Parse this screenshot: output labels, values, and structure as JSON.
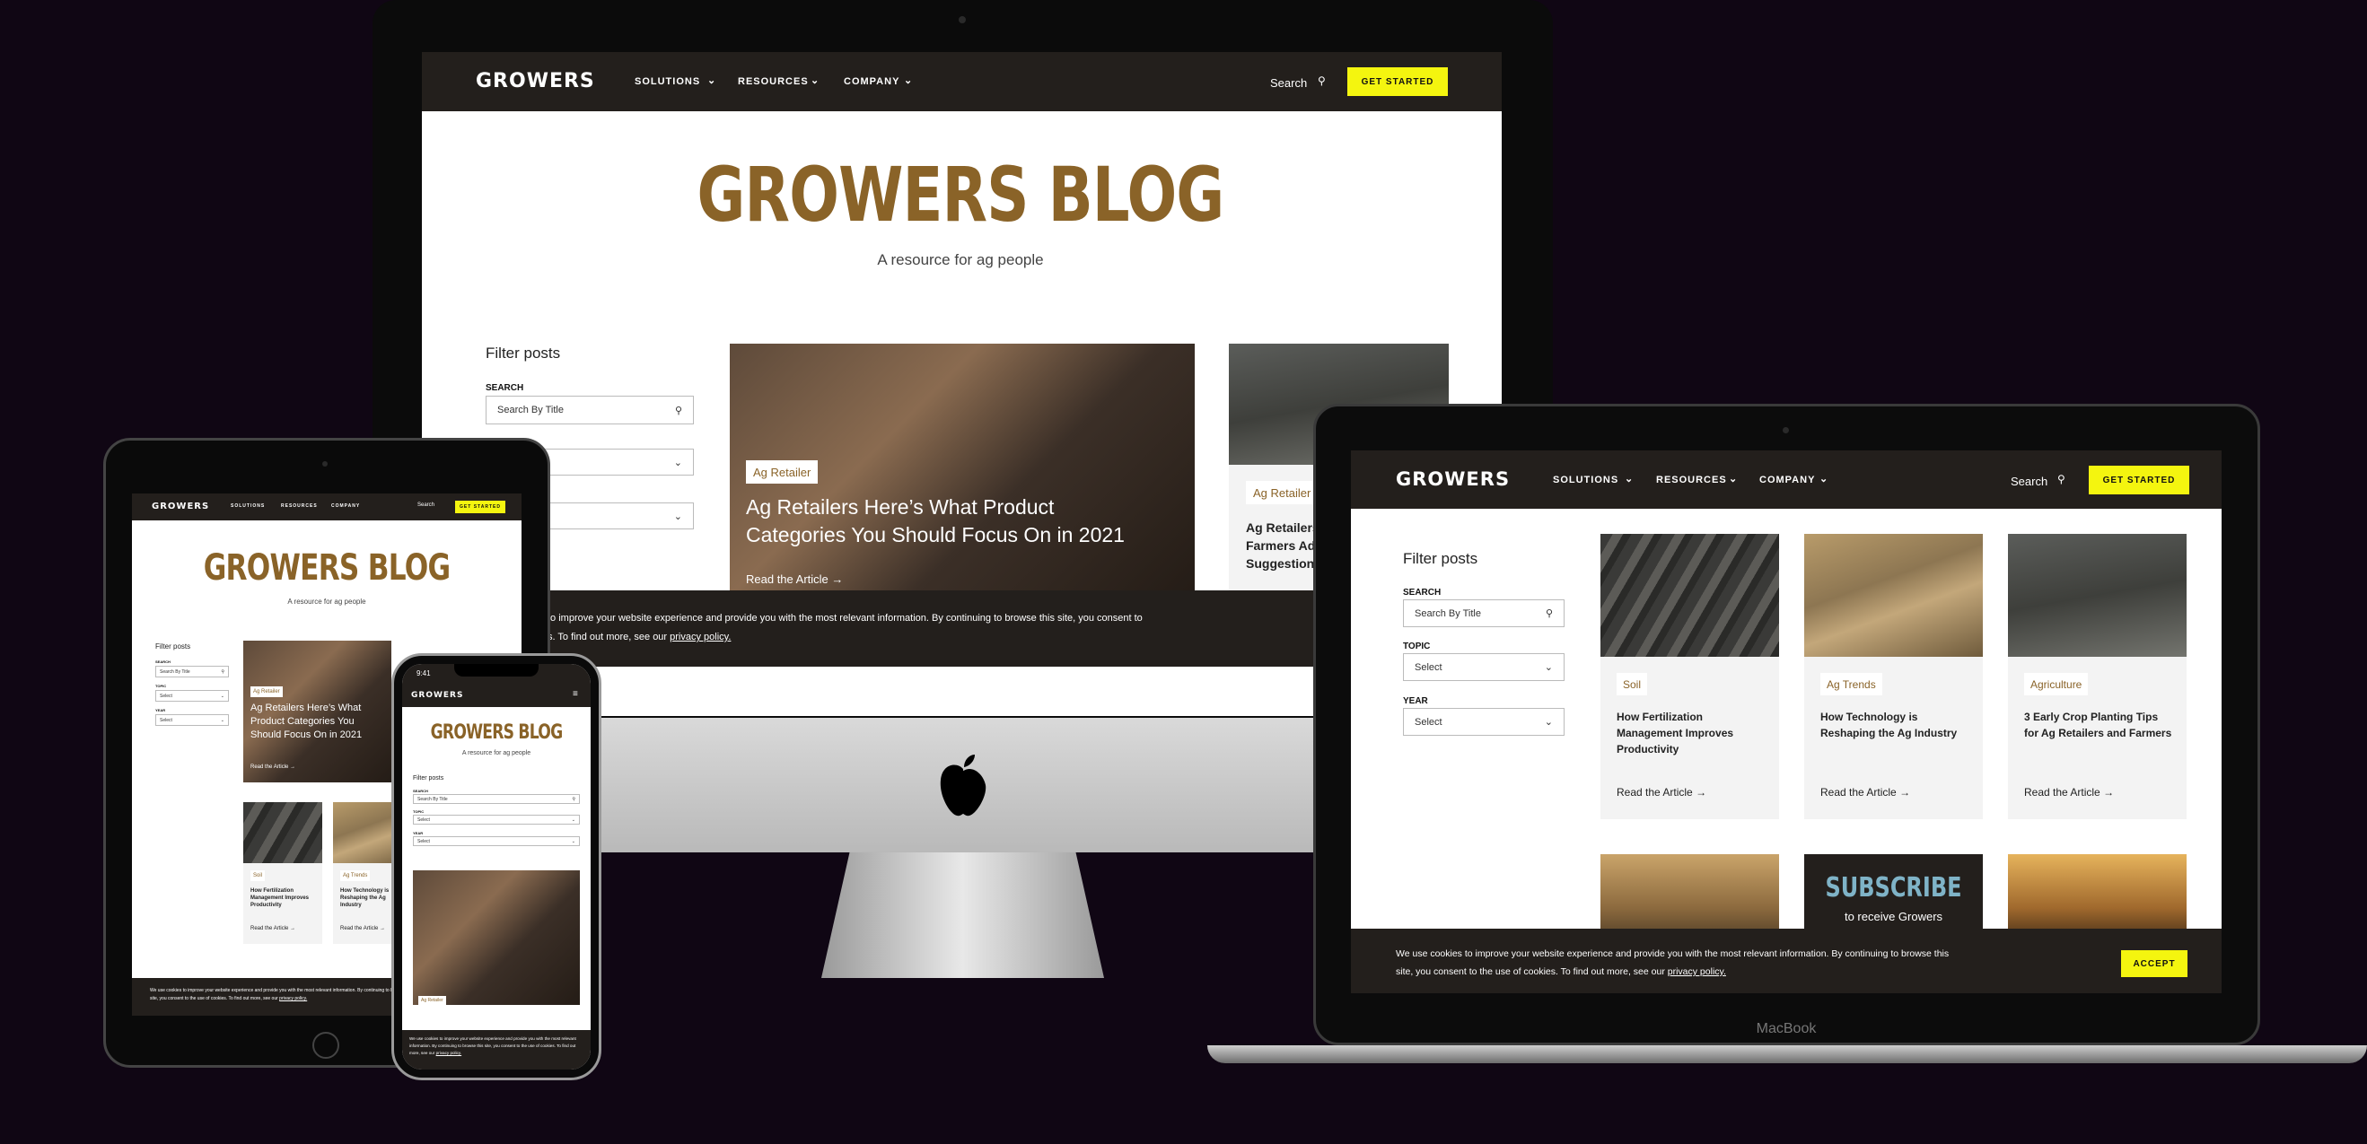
{
  "brand": {
    "logo": "GROWERS",
    "accent": "#f4f50f",
    "gold": "#8a6328",
    "dark": "#231f1c"
  },
  "nav": {
    "solutions": "SOLUTIONS",
    "resources": "RESOURCES",
    "company": "COMPANY",
    "search": "Search",
    "cta": "GET STARTED"
  },
  "hero": {
    "title": "GROWERS BLOG",
    "subtitle": "A resource for ag people"
  },
  "filter": {
    "title": "Filter posts",
    "search_label": "SEARCH",
    "search_placeholder": "Search By Title",
    "topic_label": "TOPIC",
    "year_label": "YEAR",
    "select_value": "Select"
  },
  "featured": {
    "tag": "Ag Retailer",
    "title": "Ag Retailers Here’s What Product Categories You Should Focus On in 2021",
    "link": "Read the Article"
  },
  "featured2": {
    "tag": "Ag Retailer",
    "title_line1": "Ag Retailers",
    "title_line2": "Farmers Ad",
    "title_line3": "Suggestion"
  },
  "cookie": {
    "text_imac": "to improve your website experience and provide you with the most relevant information. By continuing to browse this site, you consent to",
    "text_imac2": "s. To find out more, see our",
    "text_full": "We use cookies to improve your website experience and provide you with the most relevant information. By continuing to browse this site, you consent to the use of cookies. To find out more, see our",
    "privacy": "privacy policy.",
    "accept": "ACCEPT"
  },
  "cards": [
    {
      "tag": "Soil",
      "title": "How Fertilization Management Improves Productivity",
      "link": "Read the Article"
    },
    {
      "tag": "Ag Trends",
      "title": "How Technology is Reshaping the Ag Industry",
      "link": "Read the Article"
    },
    {
      "tag": "Agriculture",
      "title": "3 Early Crop Planting Tips for Ag Retailers and Farmers",
      "link": "Read the Article"
    }
  ],
  "subscribe": {
    "title": "SUBSCRIBE",
    "subtitle": "to receive Growers"
  },
  "devices": {
    "macbook_label": "MacBook",
    "phone_time": "9:41"
  }
}
